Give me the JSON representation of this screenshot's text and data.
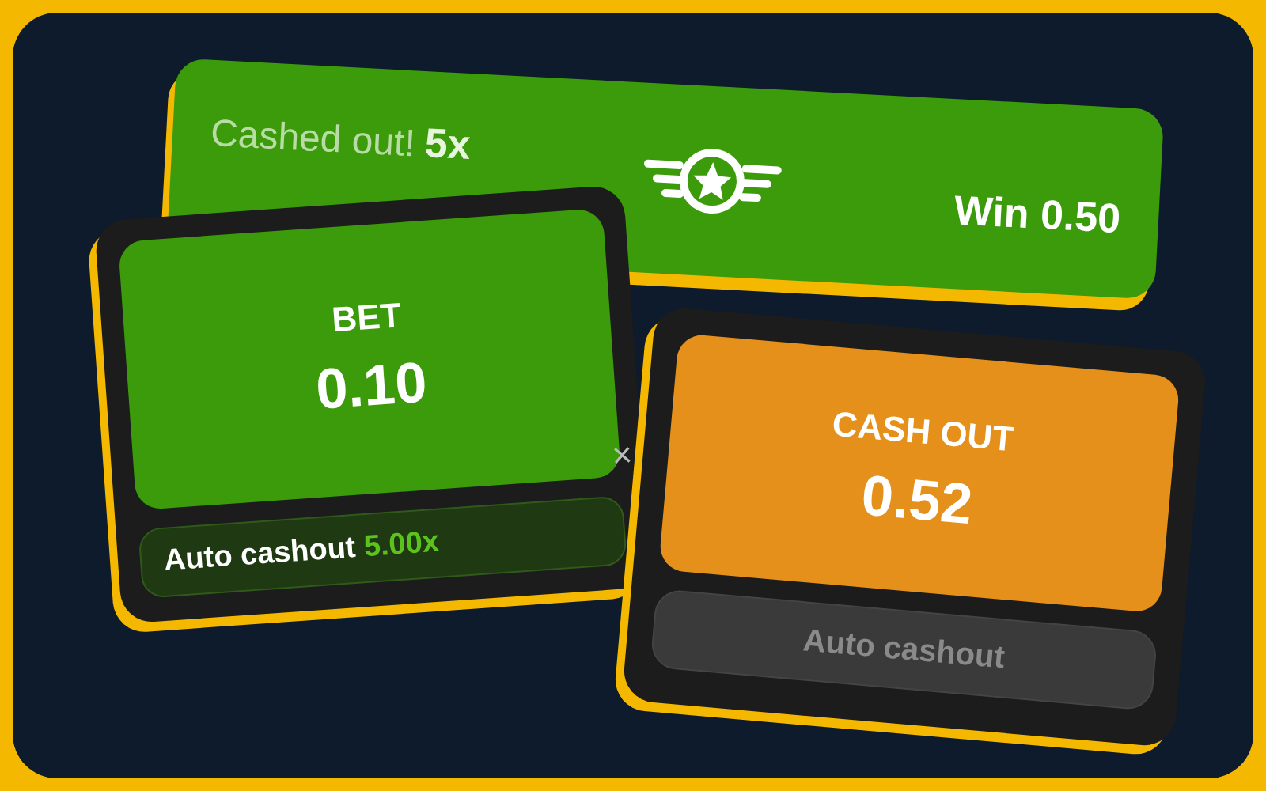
{
  "banner": {
    "label": "Cashed out!",
    "multiplier": "5x",
    "win": "Win 0.50"
  },
  "bet_card": {
    "title": "BET",
    "amount": "0.10",
    "auto_label": "Auto cashout",
    "auto_value": "5.00x",
    "close": "×",
    "auto_enabled": true
  },
  "cashout_card": {
    "title": "CASH OUT",
    "amount": "0.52",
    "auto_label": "Auto cashout",
    "auto_enabled": false
  }
}
